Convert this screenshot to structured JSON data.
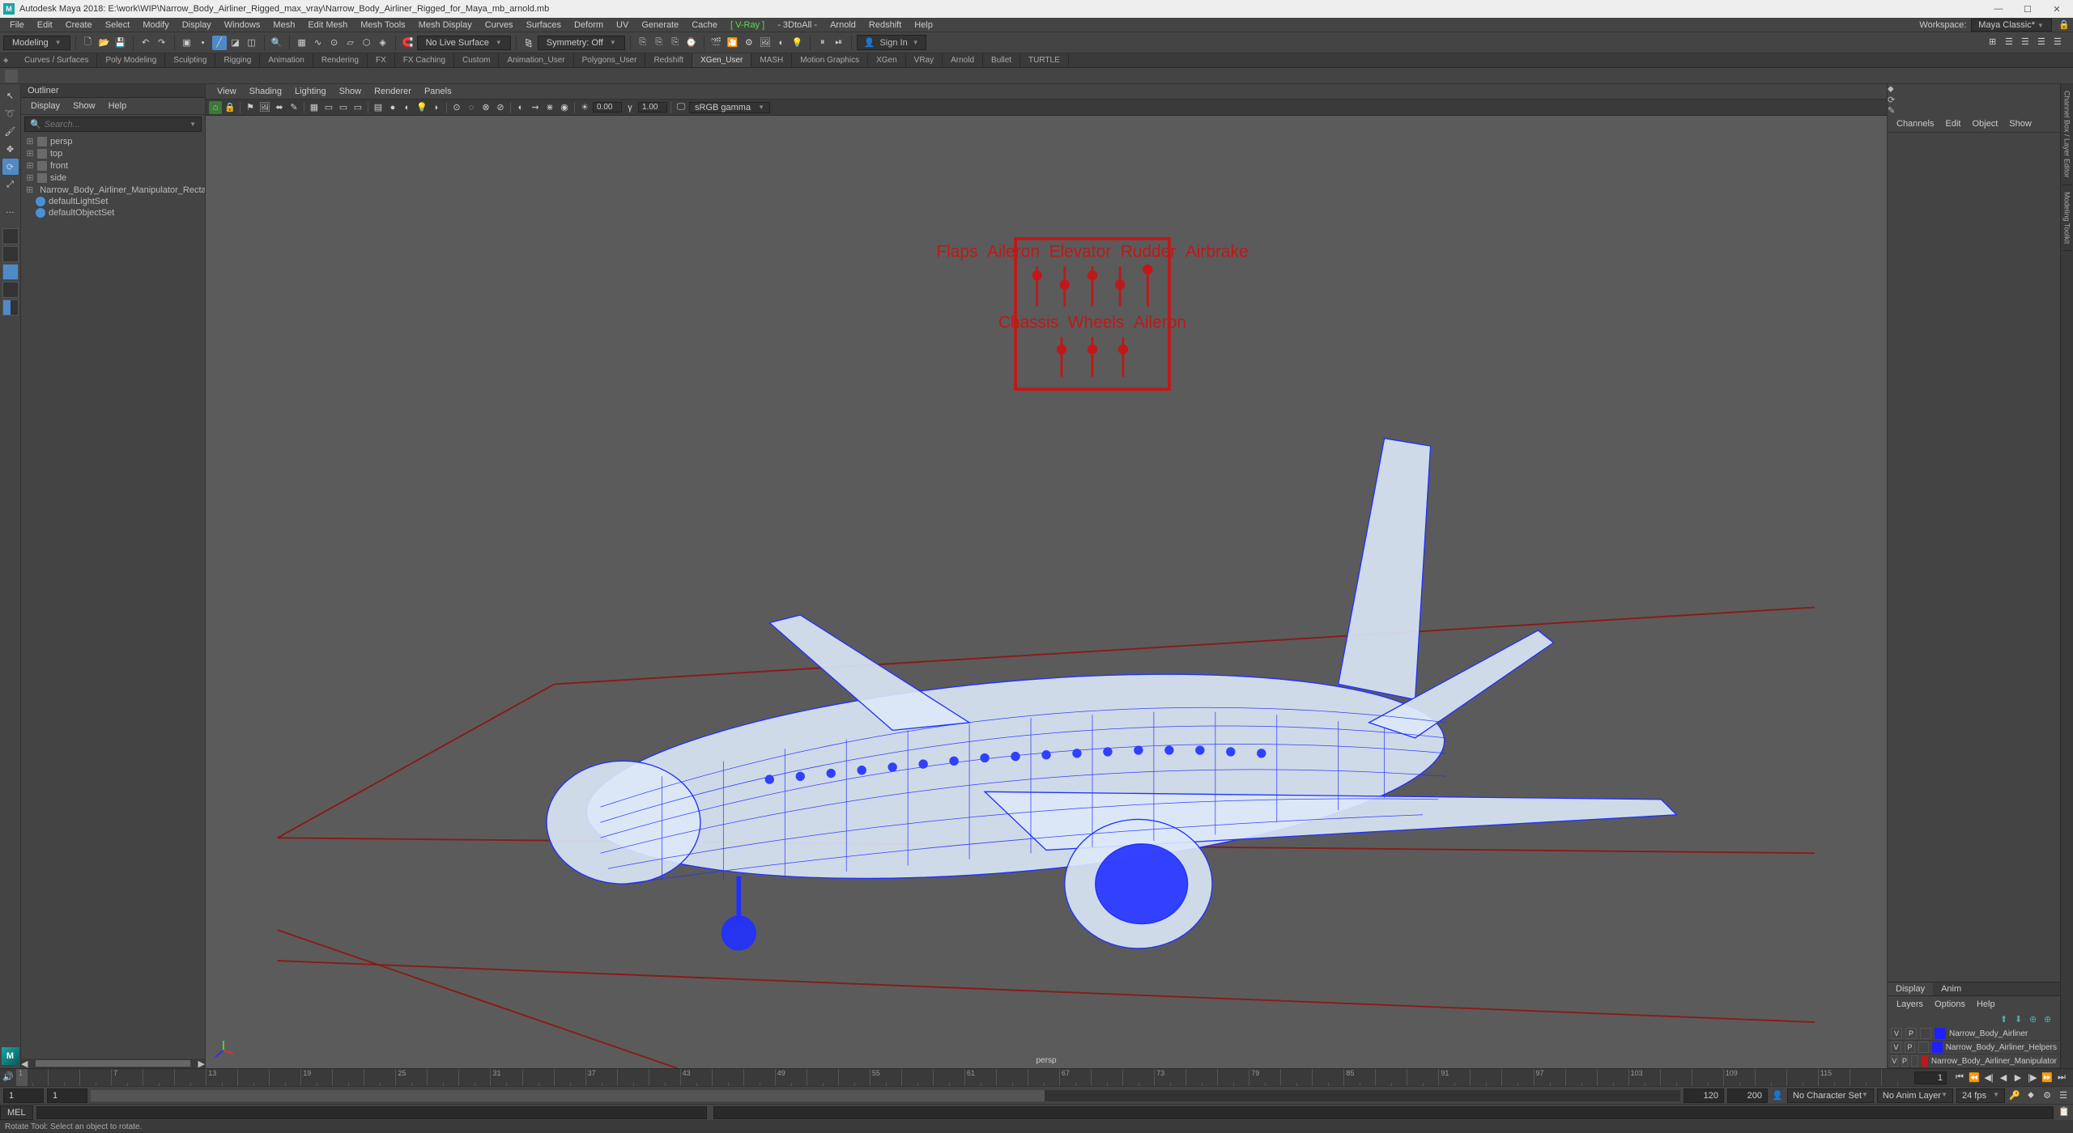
{
  "title": "Autodesk Maya 2018: E:\\work\\WIP\\Narrow_Body_Airliner_Rigged_max_vray\\Narrow_Body_Airliner_Rigged_for_Maya_mb_arnold.mb",
  "menus": [
    "File",
    "Edit",
    "Create",
    "Select",
    "Modify",
    "Display",
    "Windows",
    "Mesh",
    "Edit Mesh",
    "Mesh Tools",
    "Mesh Display",
    "Curves",
    "Surfaces",
    "Deform",
    "UV",
    "Generate",
    "Cache"
  ],
  "menus_extra": [
    "[ V-Ray ]",
    "- 3DtoAll -",
    "Arnold",
    "Redshift",
    "Help"
  ],
  "workspace": {
    "label": "Workspace:",
    "value": "Maya Classic*"
  },
  "statusline": {
    "menu_set": "Modeling",
    "no_live": "No Live Surface",
    "symmetry": "Symmetry: Off",
    "signin": "Sign In"
  },
  "shelves": [
    "Curves / Surfaces",
    "Poly Modeling",
    "Sculpting",
    "Rigging",
    "Animation",
    "Rendering",
    "FX",
    "FX Caching",
    "Custom",
    "Animation_User",
    "Polygons_User",
    "Redshift",
    "XGen_User",
    "MASH",
    "Motion Graphics",
    "XGen",
    "VRay",
    "Arnold",
    "Bullet",
    "TURTLE"
  ],
  "active_shelf": "XGen_User",
  "outliner": {
    "title": "Outliner",
    "menu": [
      "Display",
      "Show",
      "Help"
    ],
    "search": "Search...",
    "items": [
      {
        "name": "persp",
        "type": "cam"
      },
      {
        "name": "top",
        "type": "cam"
      },
      {
        "name": "front",
        "type": "cam"
      },
      {
        "name": "side",
        "type": "cam"
      },
      {
        "name": "Narrow_Body_Airliner_Manipulator_Rectangle",
        "type": "group",
        "expandable": true
      },
      {
        "name": "defaultLightSet",
        "type": "set"
      },
      {
        "name": "defaultObjectSet",
        "type": "set"
      }
    ]
  },
  "viewport": {
    "menu": [
      "View",
      "Shading",
      "Lighting",
      "Show",
      "Renderer",
      "Panels"
    ],
    "exposure": "0.00",
    "gamma": "1.00",
    "colorspace": "sRGB gamma",
    "persp": "persp",
    "control_labels_top": [
      "Flaps",
      "Aileron",
      "Elevator",
      "Rudder",
      "Airbrake"
    ],
    "control_labels_bottom": [
      "Chassis",
      "Wheels",
      "Aileron"
    ]
  },
  "channelbox": {
    "menu": [
      "Channels",
      "Edit",
      "Object",
      "Show"
    ]
  },
  "layers": {
    "tabs": [
      "Display",
      "Anim"
    ],
    "active_tab": "Display",
    "menu": [
      "Layers",
      "Options",
      "Help"
    ],
    "rows": [
      {
        "v": "V",
        "p": "P",
        "color": "#2020ff",
        "name": "Narrow_Body_Airliner"
      },
      {
        "v": "V",
        "p": "P",
        "color": "#2020ff",
        "name": "Narrow_Body_Airliner_Helpers"
      },
      {
        "v": "V",
        "p": "P",
        "color": "#c01818",
        "name": "Narrow_Body_Airliner_Manipulator"
      }
    ]
  },
  "side_tabs": [
    "Channel Box / Layer Editor",
    "Modeling Toolkit"
  ],
  "timeline": {
    "start_visible": "1",
    "end_visible": "120",
    "start_anim": "1",
    "end_anim": "120",
    "start_range": "1",
    "end_range": "200",
    "character_set": "No Character Set",
    "anim_layer": "No Anim Layer",
    "fps": "24 fps"
  },
  "cmdline": {
    "label": "MEL"
  },
  "helpline": "Rotate Tool: Select an object to rotate."
}
